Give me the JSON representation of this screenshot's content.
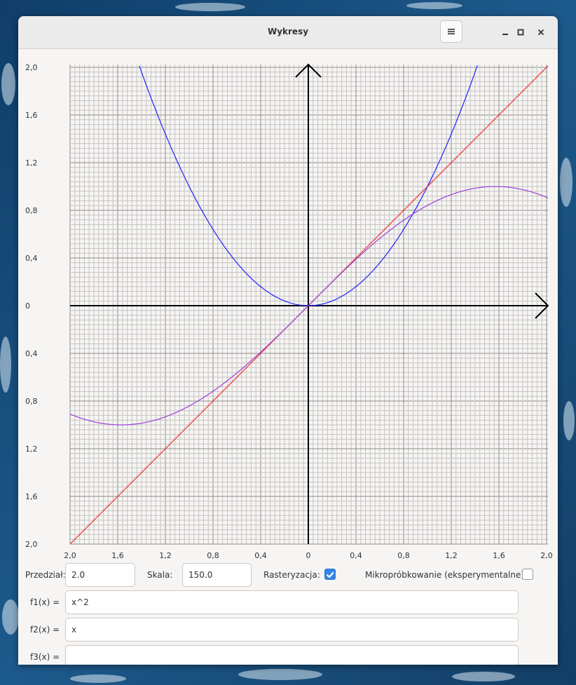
{
  "window": {
    "title": "Wykresy"
  },
  "titlebar_buttons": [
    "menu-icon",
    "minimize-icon",
    "maximize-icon",
    "close-icon"
  ],
  "chart_data": {
    "type": "line",
    "title": "",
    "xlabel": "",
    "ylabel": "",
    "xlim": [
      -2.2,
      2.2
    ],
    "ylim": [
      -2.2,
      2.2
    ],
    "grid": true,
    "x_tick_labels": [
      "2,0",
      "1,6",
      "1,2",
      "0,8",
      "0,4",
      "0",
      "0,4",
      "0,8",
      "1,2",
      "1,6",
      "2,0"
    ],
    "x_tick_values": [
      -2.0,
      -1.6,
      -1.2,
      -0.8,
      -0.4,
      0,
      0.4,
      0.8,
      1.2,
      1.6,
      2.0
    ],
    "y_tick_labels": [
      "2,0",
      "1,6",
      "1,2",
      "0,8",
      "0,4",
      "0",
      "0,4",
      "0,8",
      "1,2",
      "1,6",
      "2,0"
    ],
    "y_tick_values": [
      2.0,
      1.6,
      1.2,
      0.8,
      0.4,
      0,
      -0.4,
      -0.8,
      -1.2,
      -1.6,
      -2.0
    ],
    "series": [
      {
        "expr": "x^2",
        "color": "#1e22ff"
      },
      {
        "expr": "x",
        "color": "#f03030"
      },
      {
        "expr": "sin(x)",
        "color": "#9b3ed8"
      }
    ]
  },
  "controls": {
    "przedzial_label": "Przedział:",
    "przedzial_value": "2.0",
    "skala_label": "Skala:",
    "skala_value": "150.0",
    "rasteryzacja_label": "Rasteryzacja:",
    "rasteryzacja_checked": true,
    "mikro_label": "Mikropróbkowanie (eksperymentalne):",
    "mikro_checked": false,
    "f1_label": "f1(x) =",
    "f1_value": "x^2",
    "f2_label": "f2(x) =",
    "f2_value": "x",
    "f3_label": "f3(x) =",
    "f3_value": ""
  },
  "colors": {
    "accent": "#3584e4",
    "grid_minor": "#c6c4c1",
    "grid_major": "#8e8c8a",
    "axis": "#000000"
  }
}
